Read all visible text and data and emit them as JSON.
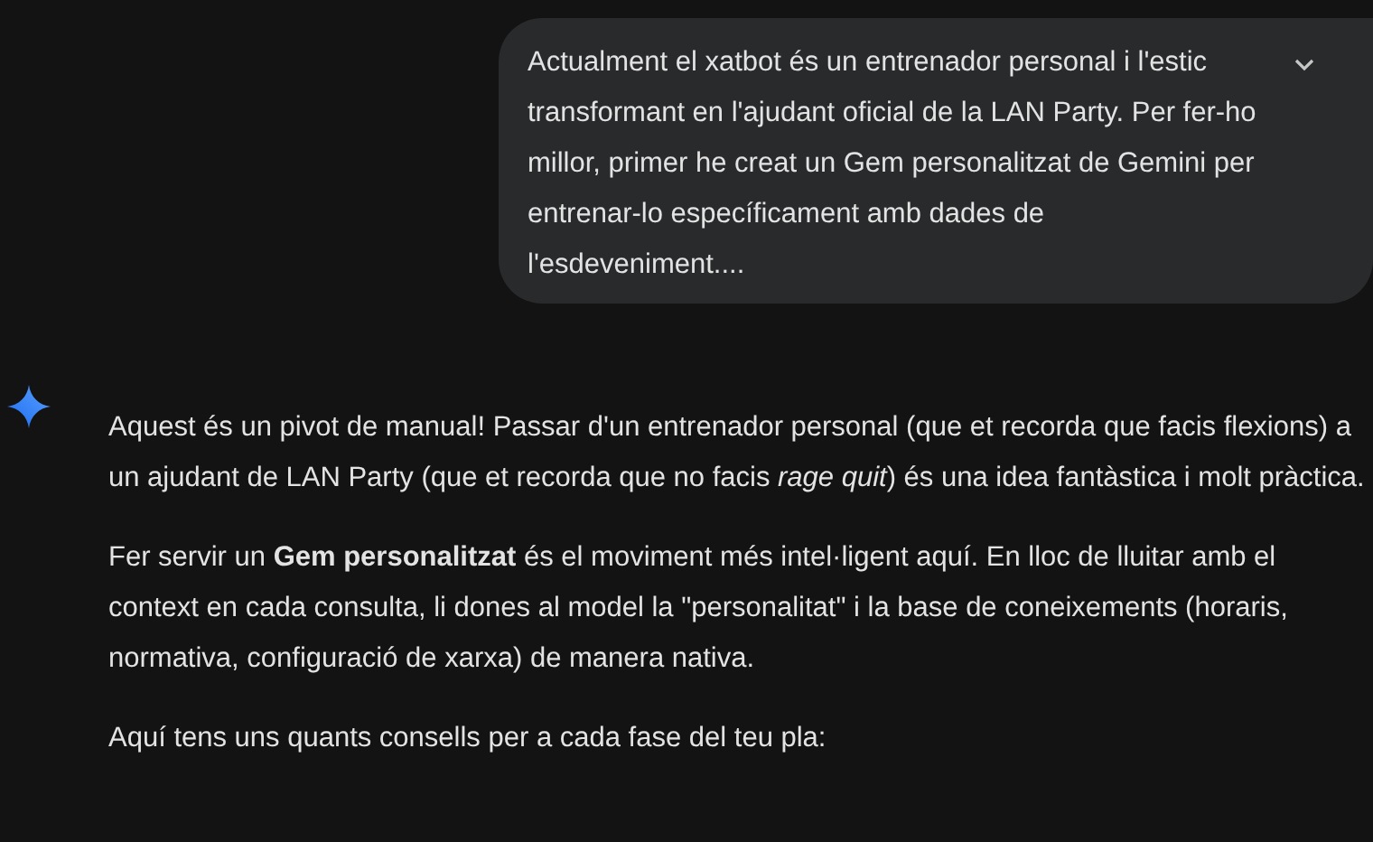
{
  "user_message": {
    "text": "Actualment el xatbot és un entrenador personal i l'estic transformant en l'ajudant oficial de la LAN Party. Per fer-ho millor, primer he creat un Gem personalitzat de Gemini per entrenar-lo específicament amb dades de l'esdeveniment....",
    "expanded": false
  },
  "response": {
    "paragraphs": [
      "Aquest és un pivot de manual! Passar d'un entrenador personal (que et recorda que facis flexions) a un ajudant de LAN Party (que et recorda que no facis *rage quit*) és una idea fantàstica i molt pràctica.",
      "Fer servir un **Gem personalitzat** és el moviment més intel·ligent aquí. En lloc de lluitar amb el context en cada consulta, li dones al model la \"personalitat\" i la base de coneixements (horaris, normativa, configuració de xarxa) de manera nativa.",
      "Aquí tens uns quants consells per a cada fase del teu pla:"
    ]
  }
}
